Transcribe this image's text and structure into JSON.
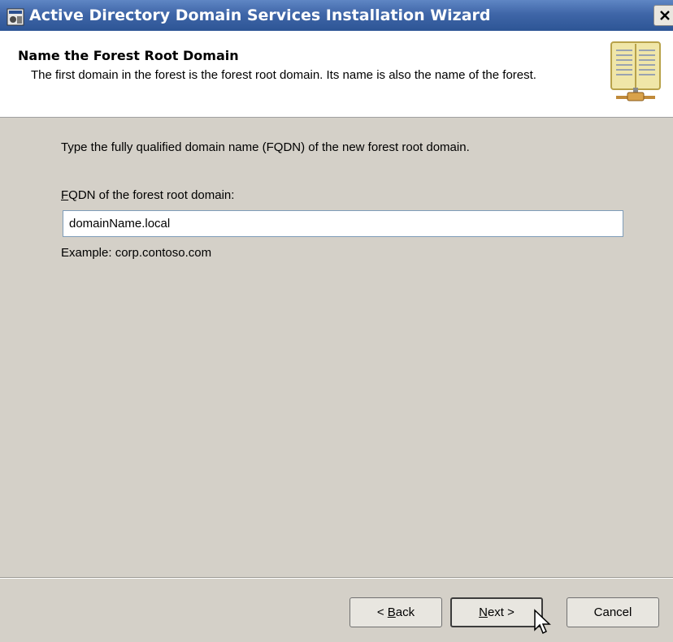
{
  "window": {
    "title": "Active Directory Domain Services Installation Wizard"
  },
  "header": {
    "title": "Name the Forest Root Domain",
    "description": "The first domain in the forest is the forest root domain. Its name is also the name of the forest."
  },
  "main": {
    "instruction": "Type the fully qualified domain name (FQDN) of the new forest root domain.",
    "fqdn_label_accel": "F",
    "fqdn_label_rest": "QDN of the forest root domain:",
    "fqdn_value": "domainName.local",
    "example": "Example: corp.contoso.com"
  },
  "buttons": {
    "back_prefix": "< ",
    "back_accel": "B",
    "back_rest": "ack",
    "next_accel": "N",
    "next_rest": "ext >",
    "cancel": "Cancel"
  },
  "colors": {
    "titlebar": "#3f66a8",
    "dialog": "#d4d0c8",
    "header": "#ffffff"
  }
}
